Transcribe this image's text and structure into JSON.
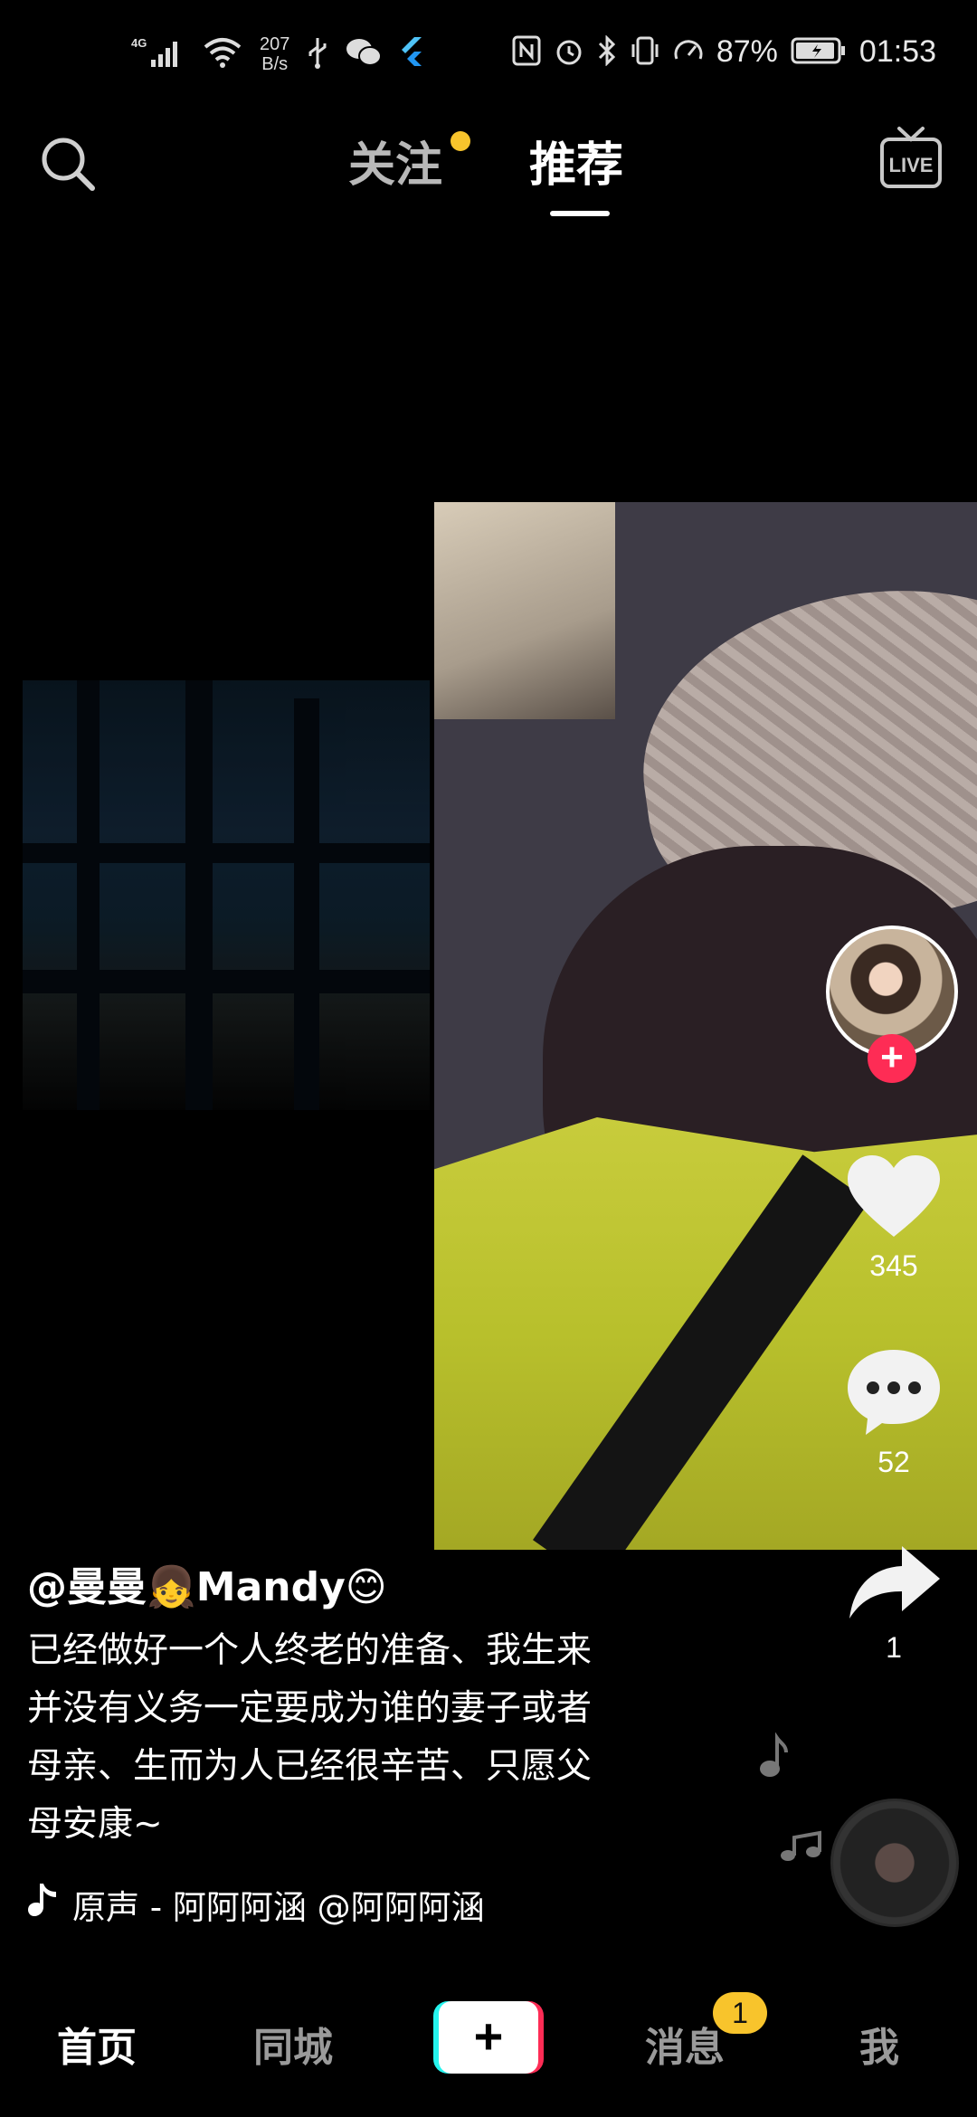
{
  "status_bar": {
    "network": "4G",
    "speed_value": "207",
    "speed_unit": "B/s",
    "battery": "87%",
    "time": "01:53"
  },
  "top_nav": {
    "tab_follow": "关注",
    "tab_recommend": "推荐",
    "live_icon": "LIVE"
  },
  "actions": {
    "likes": "345",
    "comments": "52",
    "shares": "1"
  },
  "post": {
    "author": "@曼曼👧Mandy😊",
    "caption_lines": [
      "已经做好一个人终老的准备、我生来",
      "并没有义务一定要成为谁的妻子或者",
      "母亲、生而为人已经很辛苦、只愿父",
      "母安康~"
    ],
    "music": "̃原声 - 阿阿阿涵   @阿阿阿涵"
  },
  "bottom_nav": {
    "home": "首页",
    "city": "同城",
    "create": "+",
    "messages": "消息",
    "messages_badge": "1",
    "me": "我"
  },
  "colors": {
    "accent_red": "#fe2c55",
    "accent_cyan": "#25f4ee",
    "badge_yellow": "#f8c42c"
  }
}
